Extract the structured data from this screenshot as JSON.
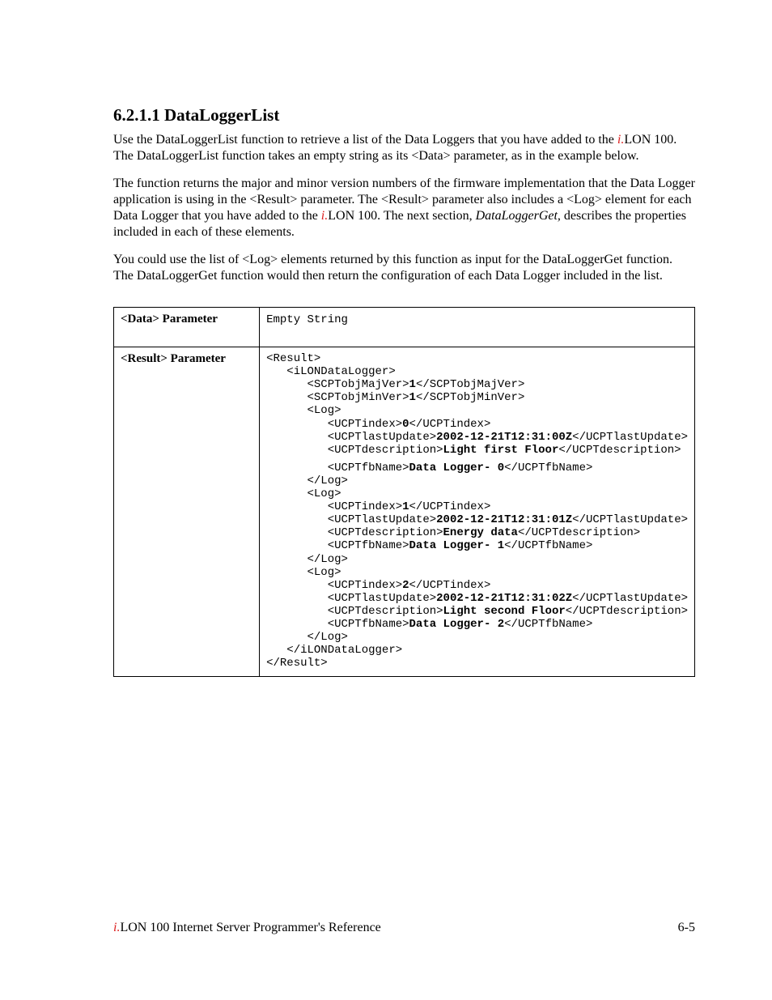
{
  "heading": "6.2.1.1 DataLoggerList",
  "p1a": "Use the DataLoggerList function to retrieve a list of the Data Loggers that you have added to the ",
  "p1i": "i.",
  "p1b": "LON 100. The DataLoggerList function takes an empty string as its <Data> parameter, as in the example below.",
  "p2a": "The function returns the major and minor version numbers of the firmware implementation that the Data Logger application is using in the <Result> parameter. The <Result> parameter also includes a <Log> element for each Data Logger that you have added to the ",
  "p2i": "i.",
  "p2b": "LON 100. The next section, ",
  "p2c": "DataLoggerGet,",
  "p2d": " describes the properties included in each of these elements.",
  "p3": "You could use the list of <Log> elements returned by this function as input for the DataLoggerGet function. The DataLoggerGet function would then return the configuration of each Data Logger included in the list.",
  "row1label": "<Data> Parameter",
  "row1value": "Empty String",
  "row2label": "<Result> Parameter",
  "xml": {
    "l01": "<Result>",
    "l02": "   <iLONDataLogger>",
    "l03": "      <SCPTobjMajVer>",
    "l03b": "1",
    "l03c": "</SCPTobjMajVer>",
    "l04": "      <SCPTobjMinVer>",
    "l04b": "1",
    "l04c": "</SCPTobjMinVer>",
    "l05": "      <Log>",
    "l06": "         <UCPTindex>",
    "l06b": "0",
    "l06c": "</UCPTindex>",
    "l07": "         <UCPTlastUpdate>",
    "l07b": "2002-12-21T12:31:00Z",
    "l07c": "</UCPTlastUpdate>",
    "l08": "         <UCPTdescription>",
    "l08b": "Light first Floor",
    "l08c": "</UCPTdescription>",
    "l09": "         <UCPTfbName>",
    "l09b": "Data Logger- 0",
    "l09c": "</UCPTfbName>",
    "l10": "      </Log>",
    "l11": "      <Log>",
    "l12": "         <UCPTindex>",
    "l12b": "1",
    "l12c": "</UCPTindex>",
    "l13": "         <UCPTlastUpdate>",
    "l13b": "2002-12-21T12:31:01Z",
    "l13c": "</UCPTlastUpdate>",
    "l14": "         <UCPTdescription>",
    "l14b": "Energy data",
    "l14c": "</UCPTdescription>",
    "l15": "         <UCPTfbName>",
    "l15b": "Data Logger- 1",
    "l15c": "</UCPTfbName>",
    "l16": "      </Log>",
    "l17": "      <Log>",
    "l18": "         <UCPTindex>",
    "l18b": "2",
    "l18c": "</UCPTindex>",
    "l19": "         <UCPTlastUpdate>",
    "l19b": "2002-12-21T12:31:02Z",
    "l19c": "</UCPTlastUpdate>",
    "l20": "         <UCPTdescription>",
    "l20b": "Light second Floor",
    "l20c": "</UCPTdescription>",
    "l21": "         <UCPTfbName>",
    "l21b": "Data Logger- 2",
    "l21c": "</UCPTfbName>",
    "l22": "      </Log>",
    "l23": "   </iLONDataLogger>",
    "l24": "</Result>"
  },
  "footer": {
    "i": "i.",
    "text": "LON 100 Internet Server Programmer's Reference",
    "page": "6-5"
  }
}
